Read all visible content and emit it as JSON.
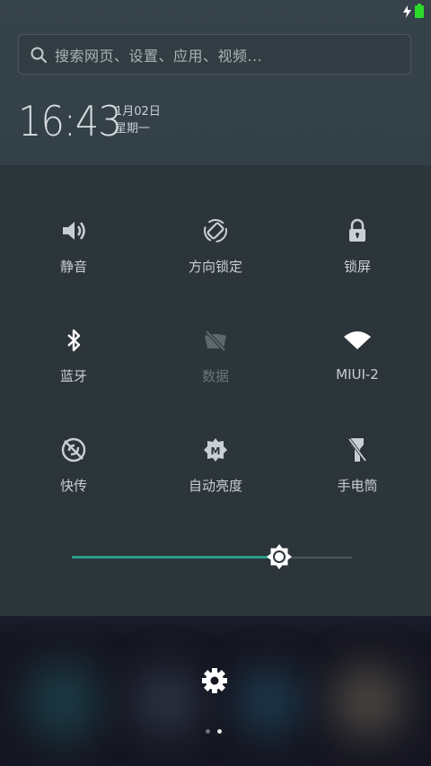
{
  "status_bar": {
    "charging_icon": "lightning-bolt",
    "battery_icon": "battery-full",
    "battery_color": "#2bdc2b"
  },
  "search": {
    "placeholder": "搜索网页、设置、应用、视频..."
  },
  "clock": {
    "time": "16:43",
    "date": "1月02日",
    "weekday": "星期一"
  },
  "toggles": [
    {
      "label": "静音",
      "icon": "speaker-icon",
      "active": true
    },
    {
      "label": "方向锁定",
      "icon": "rotation-lock-icon",
      "active": true
    },
    {
      "label": "锁屏",
      "icon": "lock-icon",
      "active": true
    },
    {
      "label": "蓝牙",
      "icon": "bluetooth-icon",
      "active": true
    },
    {
      "label": "数据",
      "icon": "mobile-data-off-icon",
      "active": false
    },
    {
      "label": "MIUI-2",
      "icon": "wifi-icon",
      "active": true
    },
    {
      "label": "快传",
      "icon": "quick-transfer-icon",
      "active": true
    },
    {
      "label": "自动亮度",
      "icon": "auto-brightness-icon",
      "active": true
    },
    {
      "label": "手电筒",
      "icon": "flashlight-icon",
      "active": true
    }
  ],
  "brightness": {
    "level": 0.74,
    "accent": "#2a9d88"
  },
  "bottom": {
    "settings_icon": "gear-icon",
    "pages": 2,
    "current_page": 2
  }
}
